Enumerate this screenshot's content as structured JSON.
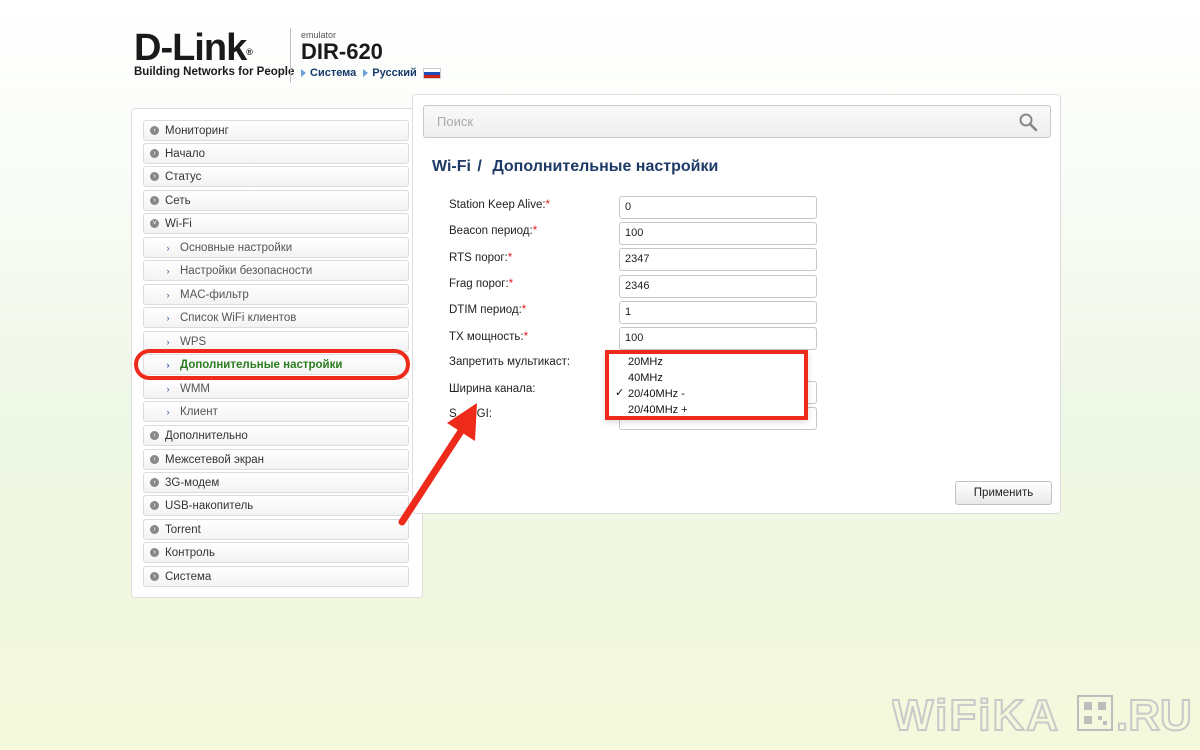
{
  "header": {
    "logo": "D-Link",
    "logo_mark": "®",
    "tagline": "Building Networks for People",
    "emulator": "emulator",
    "model": "DIR-620",
    "crumb_system": "Система",
    "crumb_language": "Русский"
  },
  "sidebar": {
    "items": [
      {
        "label": "Мониторинг"
      },
      {
        "label": "Начало"
      },
      {
        "label": "Статус"
      },
      {
        "label": "Сеть"
      },
      {
        "label": "Wi-Fi"
      },
      {
        "label": "Основные настройки"
      },
      {
        "label": "Настройки безопасности"
      },
      {
        "label": "MAC-фильтр"
      },
      {
        "label": "Список WiFi клиентов"
      },
      {
        "label": "WPS"
      },
      {
        "label": "Дополнительные настройки"
      },
      {
        "label": "WMM"
      },
      {
        "label": "Клиент"
      },
      {
        "label": "Дополнительно"
      },
      {
        "label": "Межсетевой экран"
      },
      {
        "label": "3G-модем"
      },
      {
        "label": "USB-накопитель"
      },
      {
        "label": "Torrent"
      },
      {
        "label": "Контроль"
      },
      {
        "label": "Система"
      }
    ]
  },
  "search": {
    "placeholder": "Поиск"
  },
  "page": {
    "title_section": "Wi-Fi",
    "title_sep": "/",
    "title_page": "Дополнительные настройки"
  },
  "form": {
    "required_mark": "*",
    "fields": [
      {
        "label": "Station Keep Alive:",
        "value": "0"
      },
      {
        "label": "Beacon период:",
        "value": "100"
      },
      {
        "label": "RTS порог:",
        "value": "2347"
      },
      {
        "label": "Frag порог:",
        "value": "2346"
      },
      {
        "label": "DTIM период:",
        "value": "1"
      },
      {
        "label": "TX мощность:",
        "value": "100"
      }
    ],
    "multicast_label": "Запретить мультикаст:",
    "channel_width_label": "Ширина канала:",
    "sgi_label_visible": "S",
    "sgi_label_tail": "GI:"
  },
  "dropdown": {
    "options": [
      "20MHz",
      "40MHz",
      "20/40MHz -",
      "20/40MHz +"
    ],
    "selected_index": 2,
    "check_mark": "✓"
  },
  "buttons": {
    "apply": "Применить"
  },
  "watermark": {
    "text": "WiFiKA",
    "suffix": ".RU"
  },
  "colors": {
    "accent_red": "#ee2a1b",
    "title_blue": "#1e3a66",
    "active_green": "#2a7d1f"
  }
}
